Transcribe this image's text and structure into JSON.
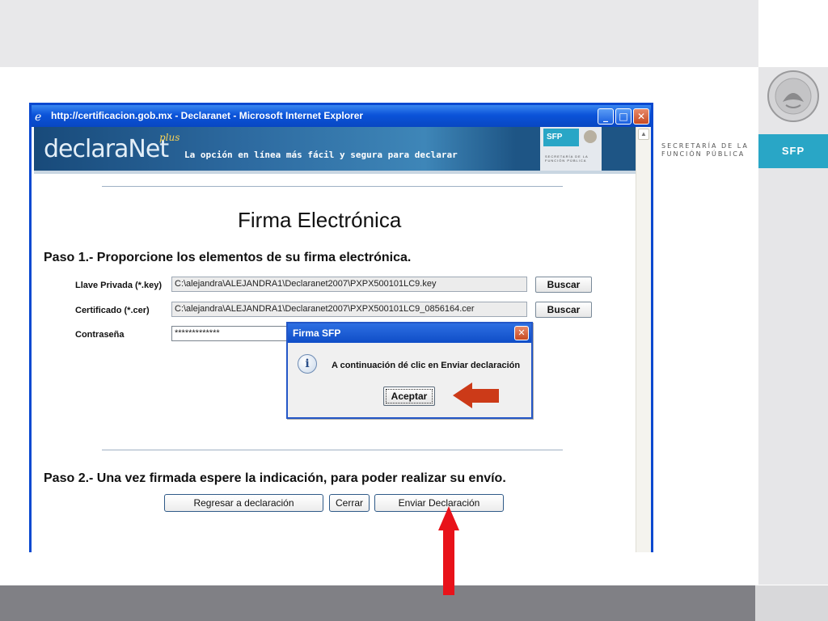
{
  "slide": {
    "right_logo_text": "SFP",
    "secretaria_line1": "SECRETARÍA DE LA",
    "secretaria_line2": "FUNCIÓN PÚBLICA"
  },
  "window": {
    "title": "http://certificacion.gob.mx - Declaranet - Microsoft Internet Explorer",
    "minimize": "_",
    "maximize": "□",
    "close": "✕"
  },
  "banner": {
    "logo": "declaraNet",
    "logo_plus": "plus",
    "tagline": "La opción  en línea más fácil y segura para declarar",
    "sfp": "SFP",
    "sfp_small": "SECRETARÍA DE LA FUNCIÓN PÚBLICA"
  },
  "page": {
    "title": "Firma Electrónica",
    "step1": "Paso 1.- Proporcione los elementos de su firma electrónica.",
    "step2": "Paso 2.- Una vez firmada espere la indicación, para poder realizar su envío."
  },
  "form": {
    "key_label": "Llave Privada (*.key)",
    "key_value": "C:\\alejandra\\ALEJANDRA1\\Declaranet2007\\PXPX500101LC9.key",
    "cer_label": "Certificado (*.cer)",
    "cer_value": "C:\\alejandra\\ALEJANDRA1\\Declaranet2007\\PXPX500101LC9_0856164.cer",
    "pass_label": "Contraseña",
    "pass_value": "*************",
    "buscar": "Buscar"
  },
  "buttons": {
    "regresar": "Regresar a declaración",
    "cerrar": "Cerrar",
    "enviar": "Enviar Declaración"
  },
  "dialog": {
    "title": "Firma SFP",
    "message": "A continuación dé clic en Enviar declaración",
    "accept": "Aceptar",
    "info_glyph": "i"
  },
  "colors": {
    "arrow_dialog": "#cc3a18",
    "arrow_submit": "#e8121a",
    "sfp_blue": "#29a6c6"
  }
}
